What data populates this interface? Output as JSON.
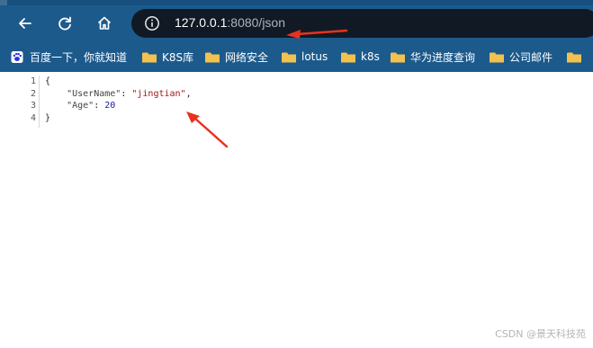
{
  "browser": {
    "url_host": "127.0.0.1",
    "url_rest": ":8080/json"
  },
  "bookmarks": [
    {
      "label": "百度一下，你就知道",
      "icon": "paw-icon"
    },
    {
      "label": "K8S库",
      "icon": "folder-icon"
    },
    {
      "label": "网络安全",
      "icon": "folder-icon"
    },
    {
      "label": "lotus",
      "icon": "folder-icon"
    },
    {
      "label": "k8s",
      "icon": "folder-icon"
    },
    {
      "label": "华为进度查询",
      "icon": "folder-icon"
    },
    {
      "label": "公司邮件",
      "icon": "folder-icon"
    },
    {
      "label": "",
      "icon": "folder-icon"
    }
  ],
  "code": {
    "line_numbers": [
      "1",
      "2",
      "3",
      "4"
    ],
    "open_brace": "{",
    "key_username": "\"UserName\"",
    "sep1": ": ",
    "val_username": "\"jingtian\"",
    "comma": ",",
    "key_age": "\"Age\"",
    "sep2": ": ",
    "val_age": "20",
    "close_brace": "}"
  },
  "watermark": "CSDN @景天科技苑",
  "colors": {
    "chrome_bg": "#1c5a8c",
    "omnibox_bg": "#111a24",
    "folder": "#f2c14e",
    "annotation_arrow": "#e8321e"
  }
}
